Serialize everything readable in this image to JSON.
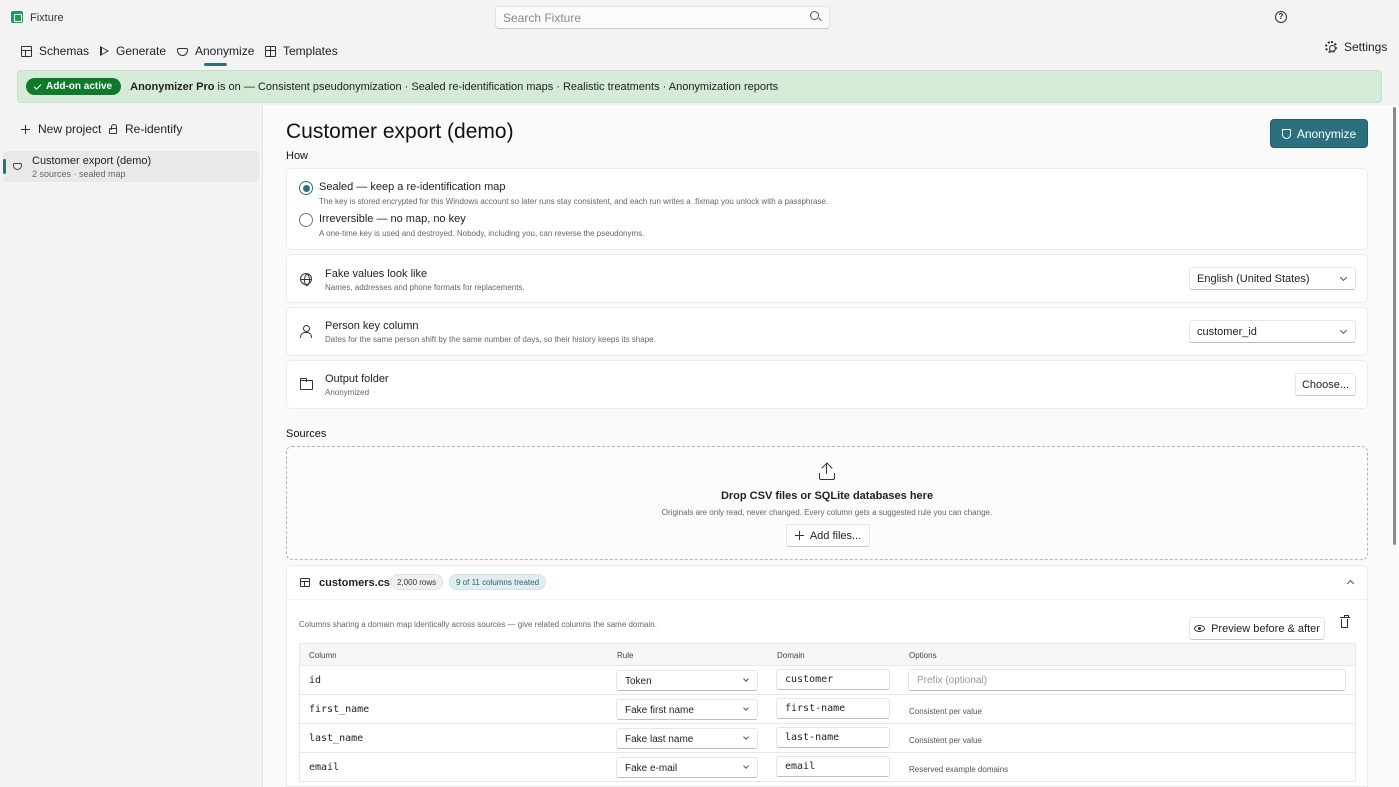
{
  "app": {
    "title": "Fixture",
    "search_placeholder": "Search Fixture",
    "help_label": "?"
  },
  "nav": {
    "tabs": [
      {
        "label": "Schemas",
        "icon": "table-icon"
      },
      {
        "label": "Generate",
        "icon": "play-icon"
      },
      {
        "label": "Anonymize",
        "icon": "mask-icon",
        "active": true
      },
      {
        "label": "Templates",
        "icon": "grid-icon"
      }
    ],
    "settings_label": "Settings"
  },
  "banner": {
    "badge": "Add-on active",
    "product": "Anonymizer Pro",
    "text": " is on — Consistent pseudonymization · Sealed re-identification maps · Realistic treatments · Anonymization reports"
  },
  "sidebar": {
    "new_project": "New project",
    "reidentify": "Re-identify",
    "projects": [
      {
        "title": "Customer export (demo)",
        "subtitle": "2 sources · sealed map",
        "selected": true
      }
    ]
  },
  "main": {
    "title": "Customer export (demo)",
    "primary_button": "Anonymize",
    "how_label": "How",
    "modes": [
      {
        "title": "Sealed — keep a re-identification map",
        "desc": "The key is stored encrypted for this Windows account so later runs stay consistent, and each run writes a .fixmap you unlock with a passphrase.",
        "selected": true
      },
      {
        "title": "Irreversible — no map, no key",
        "desc": "A one-time key is used and destroyed. Nobody, including you, can reverse the pseudonyms.",
        "selected": false
      }
    ],
    "settings": {
      "locale": {
        "title": "Fake values look like",
        "desc": "Names, addresses and phone formats for replacements.",
        "value": "English (United States)"
      },
      "person_key": {
        "title": "Person key column",
        "desc": "Dates for the same person shift by the same number of days, so their history keeps its shape.",
        "value": "customer_id"
      },
      "output": {
        "title": "Output folder",
        "desc": "Anonymized",
        "button": "Choose..."
      }
    },
    "sources_label": "Sources",
    "dropzone": {
      "title": "Drop CSV files or SQLite databases here",
      "desc": "Originals are only read, never changed. Every column gets a suggested rule you can change.",
      "button": "Add files..."
    },
    "source": {
      "name": "customers.csv",
      "rows_badge": "2,000 rows",
      "treated_badge": "9 of 11 columns treated",
      "note": "Columns sharing a domain map identically across sources — give related columns the same domain.",
      "preview_button": "Preview before & after",
      "columns_header": {
        "column": "Column",
        "rule": "Rule",
        "domain": "Domain",
        "options": "Options"
      },
      "rows": [
        {
          "column": "id",
          "rule": "Token",
          "domain": "customer",
          "option_placeholder": "Prefix (optional)",
          "option": ""
        },
        {
          "column": "first_name",
          "rule": "Fake first name",
          "domain": "first-name",
          "option": "Consistent per value"
        },
        {
          "column": "last_name",
          "rule": "Fake last name",
          "domain": "last-name",
          "option": "Consistent per value"
        },
        {
          "column": "email",
          "rule": "Fake e-mail",
          "domain": "email",
          "option": "Reserved example domains"
        }
      ]
    }
  },
  "colors": {
    "accent": "#2c7080",
    "badge": "#0e7a2a",
    "banner_bg": "#d5ead7"
  }
}
